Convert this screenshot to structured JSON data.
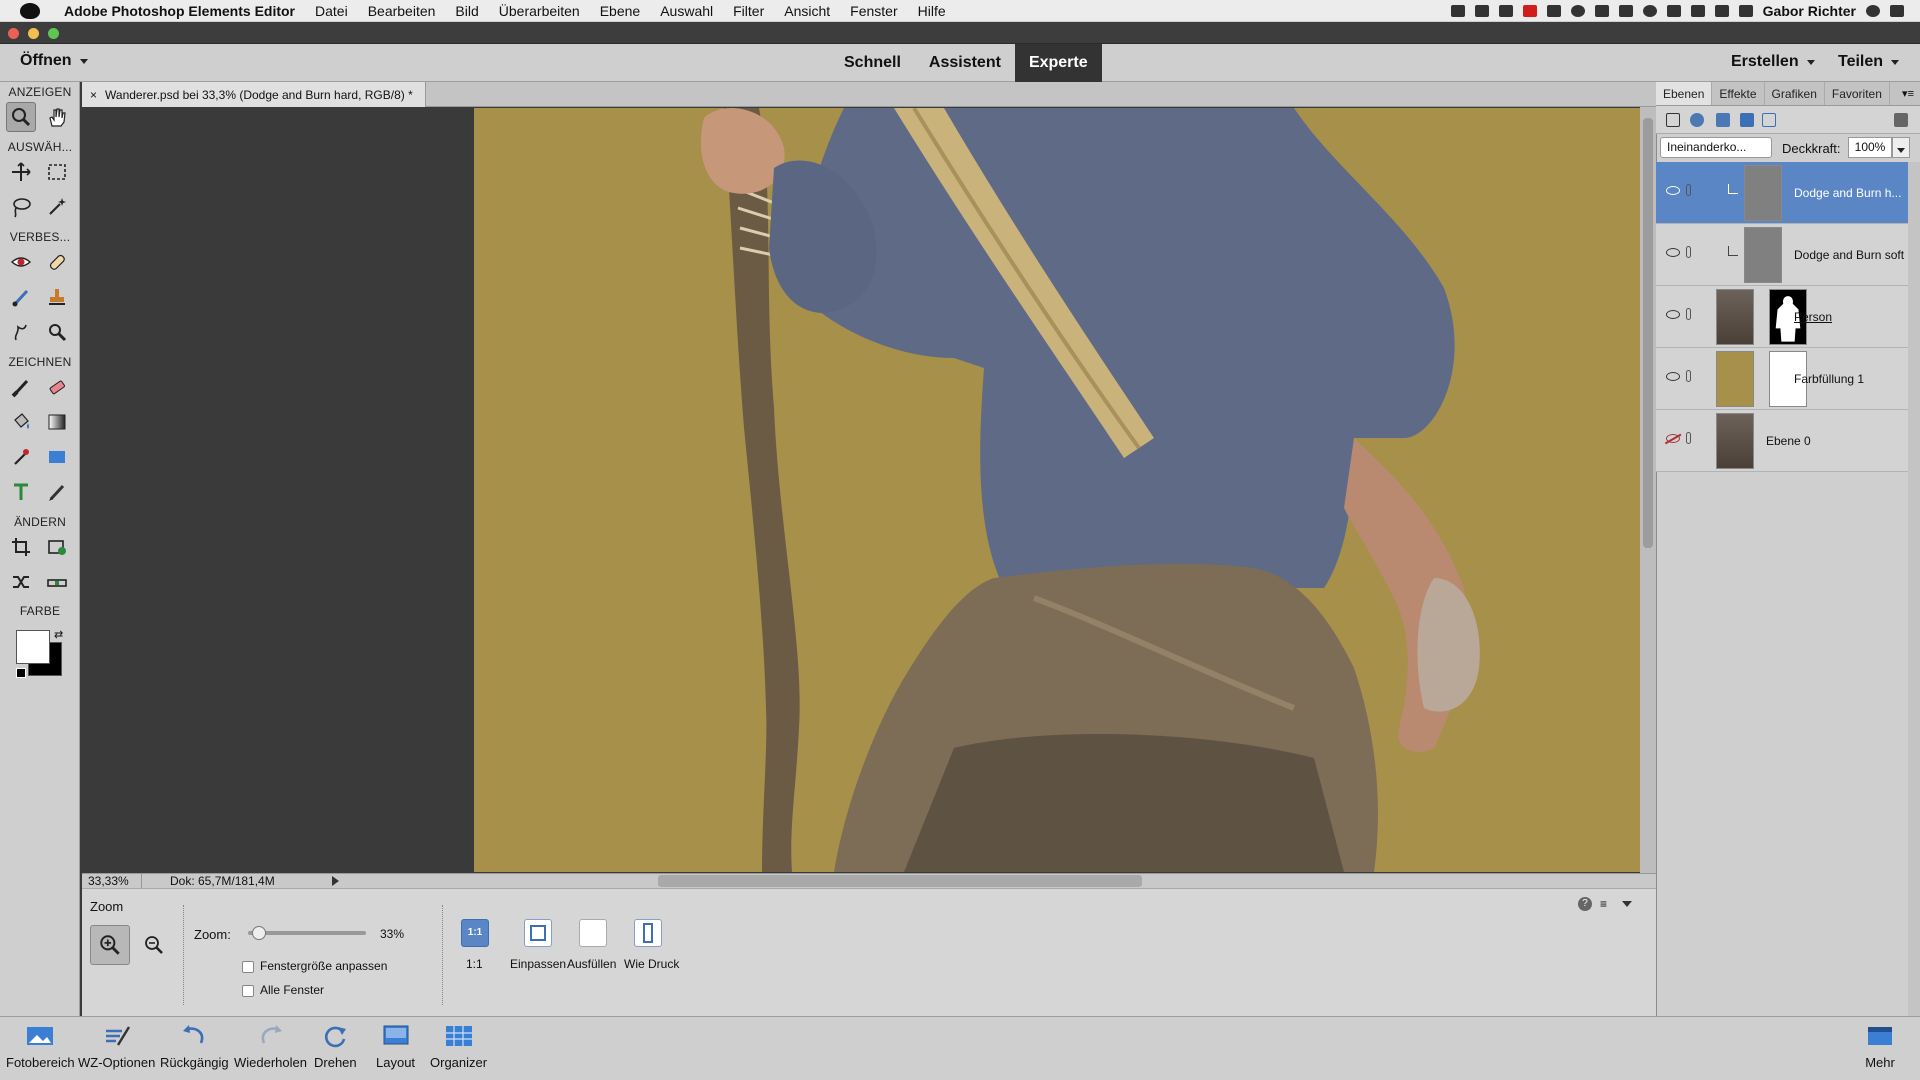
{
  "menubar": {
    "app_name": "Adobe Photoshop Elements Editor",
    "items": [
      "Datei",
      "Bearbeiten",
      "Bild",
      "Überarbeiten",
      "Ebene",
      "Auswahl",
      "Filter",
      "Ansicht",
      "Fenster",
      "Hilfe"
    ],
    "user": "Gabor Richter"
  },
  "modebar": {
    "open_label": "Öffnen",
    "tabs": [
      "Schnell",
      "Assistent",
      "Experte"
    ],
    "active_tab": "Experte",
    "create_label": "Erstellen",
    "share_label": "Teilen"
  },
  "toolbox": {
    "sections": [
      "ANZEIGEN",
      "AUSWÄH...",
      "VERBES...",
      "ZEICHNEN",
      "ÄNDERN",
      "FARBE"
    ]
  },
  "document": {
    "tab_title": "Wanderer.psd bei 33,3% (Dodge and Burn hard, RGB/8) *",
    "close_glyph": "×",
    "zoom_status": "33,33%",
    "doc_info": "Dok: 65,7M/181,4M",
    "image_bg_color": "#a6904a"
  },
  "tool_options": {
    "tool_name": "Zoom",
    "zoom_label": "Zoom:",
    "zoom_value": "33%",
    "zoom_fraction": 0.33,
    "checkbox_fit": "Fenstergröße anpassen",
    "checkbox_all": "Alle Fenster",
    "view_buttons": [
      "1:1",
      "Einpassen",
      "Ausfüllen",
      "Wie Druck"
    ],
    "button_1to1_glyph": "1:1"
  },
  "bottombar": {
    "items": [
      "Fotobereich",
      "WZ-Optionen",
      "Rückgängig",
      "Wiederholen",
      "Drehen",
      "Layout",
      "Organizer"
    ],
    "more": "Mehr"
  },
  "layers_panel": {
    "tabs": [
      "Ebenen",
      "Effekte",
      "Grafiken",
      "Favoriten"
    ],
    "active_tab": "Ebenen",
    "blend_mode": "Ineinanderko...",
    "opacity_label": "Deckkraft:",
    "opacity_value": "100%",
    "layers": [
      {
        "name": "Dodge and Burn h...",
        "selected": true,
        "visible": true
      },
      {
        "name": "Dodge and Burn soft",
        "selected": false,
        "visible": true
      },
      {
        "name": "Person",
        "selected": false,
        "visible": true
      },
      {
        "name": "Farbfüllung 1",
        "selected": false,
        "visible": true
      },
      {
        "name": "Ebene 0",
        "selected": false,
        "visible": false
      }
    ]
  }
}
